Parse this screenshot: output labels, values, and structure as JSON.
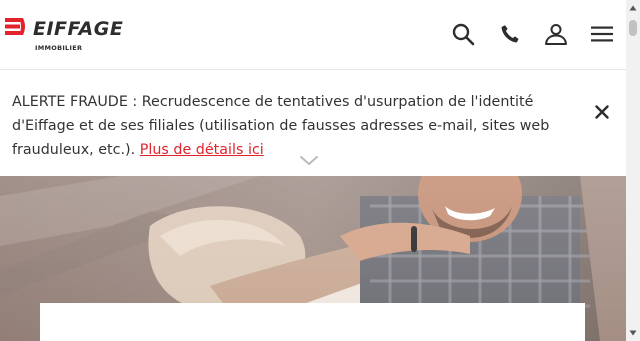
{
  "header": {
    "logo": {
      "brand": "EIFFAGE",
      "subtitle": "IMMOBILIER",
      "icon": "eiffage-logo-mark"
    },
    "icons": [
      "search-icon",
      "phone-icon",
      "user-icon",
      "menu-icon"
    ]
  },
  "alert": {
    "text": "ALERTE FRAUDE : Recrudescence de tentatives d'usurpation de l'identité d'Eiffage et de ses filiales (utilisation de fausses adresses e-mail, sites web frauduleux, etc.).",
    "link_label": "Plus de détails ici",
    "close_icon": "close-icon",
    "expand_icon": "chevron-down-icon"
  },
  "colors": {
    "brand_red": "#e2232b",
    "text_dark": "#333333",
    "icon_dark": "#2d2d2d"
  }
}
